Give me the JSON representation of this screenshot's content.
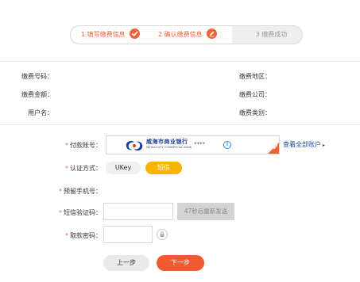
{
  "stepper": {
    "steps": [
      {
        "label": "1 填写缴费信息",
        "state": "done"
      },
      {
        "label": "2 确认缴费信息",
        "state": "active"
      },
      {
        "label": "3 缴费成功",
        "state": "pending"
      }
    ]
  },
  "info": {
    "payment_no_label": "缴费号码：",
    "payment_region_label": "缴费地区：",
    "payment_amount_label": "缴费金额：",
    "payment_company_label": "缴费公司：",
    "user_name_label": "用户名：",
    "payment_type_label": "缴费类别："
  },
  "form": {
    "account_label": "付款账号：",
    "bank_name": "威海市商业银行",
    "bank_name_en": "WEIHAI CITY COMMERCIAL BANK",
    "account_masked": "****",
    "info_icon_text": "i",
    "view_all_accounts": "查看全部账户",
    "auth_label": "认证方式：",
    "auth_options": [
      "UKey",
      "短信"
    ],
    "auth_selected": "短信",
    "phone_label": "预留手机号：",
    "sms_code_label": "短信验证码：",
    "resend_label": "47秒后重新发送",
    "withdraw_pwd_label": "取款密码："
  },
  "buttons": {
    "prev_label": "上一步",
    "next_label": "下一步"
  },
  "colors": {
    "accent": "#f0623a",
    "auth_selected_bg": "#f7b500",
    "link": "#1a4a9c",
    "bank_blue": "#1c3f92"
  }
}
